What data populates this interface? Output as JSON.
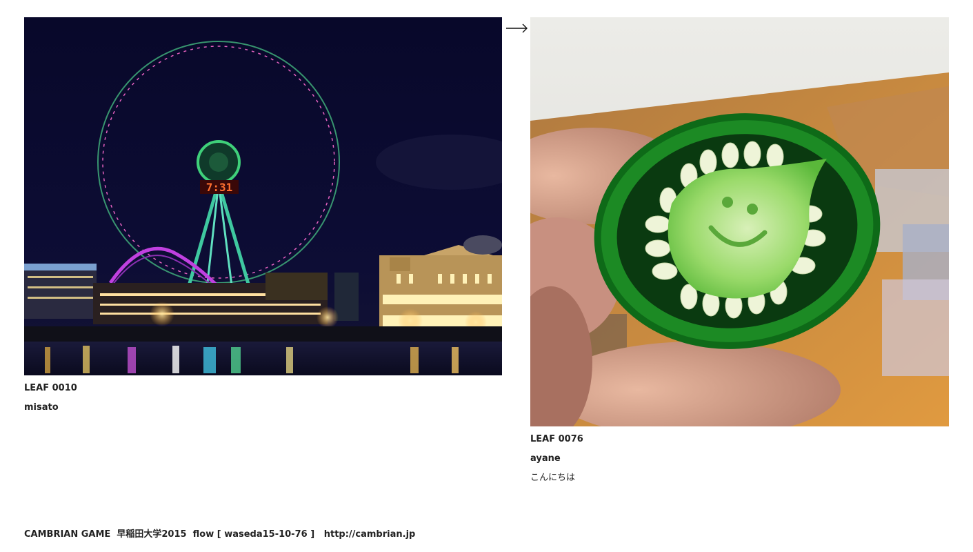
{
  "leaves": [
    {
      "id_label": "LEAF 0010",
      "author": "misato",
      "message": "",
      "photo_icon": "ferris-wheel-night-photo",
      "clock_text": "7:31"
    },
    {
      "id_label": "LEAF 0076",
      "author": "ayane",
      "message": "こんにちは",
      "photo_icon": "green-pepper-smiley-photo"
    }
  ],
  "flow_arrow": "⟶",
  "footer": {
    "project": "CAMBRIAN GAME",
    "event": "早稲田大学2015",
    "flow": "flow [ waseda15-10-76 ]",
    "url": "http://cambrian.jp"
  },
  "colors": {
    "night_sky": "#0b0b2e",
    "pepper_green": "#1e8a1e",
    "text": "#222222"
  }
}
